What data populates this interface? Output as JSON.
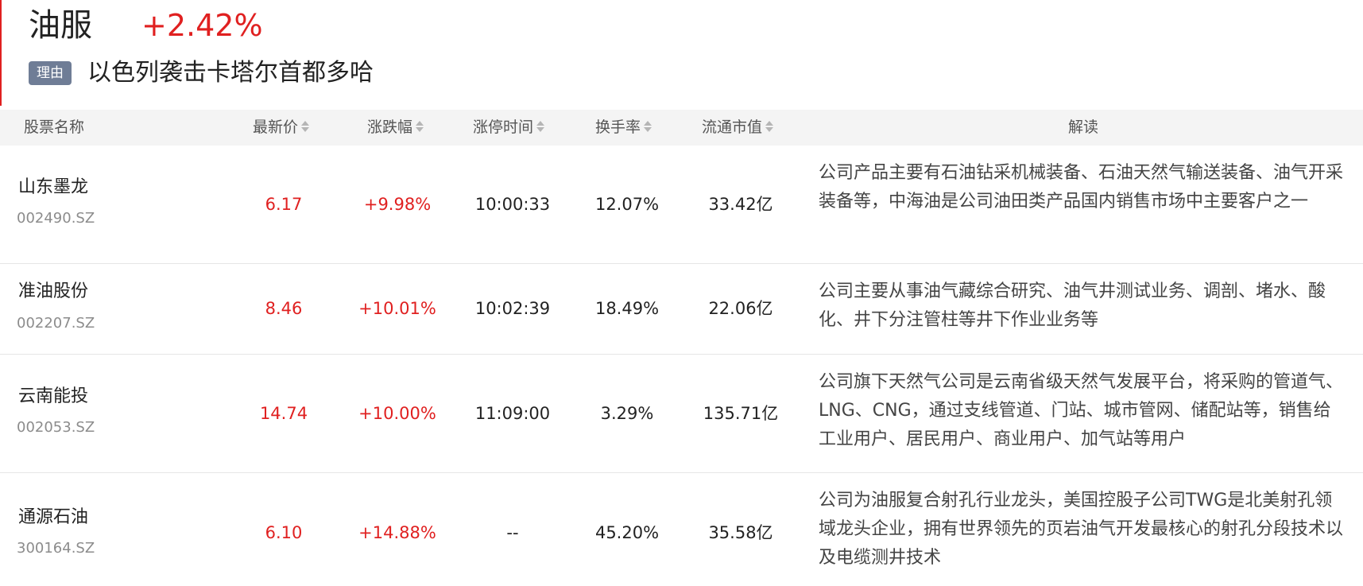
{
  "sector": {
    "name": "油服",
    "change": "+2.42%",
    "reason_tag": "理由",
    "reason_text": "以色列袭击卡塔尔首都多哈"
  },
  "columns": {
    "name": "股票名称",
    "price": "最新价",
    "change": "涨跌幅",
    "limit_time": "涨停时间",
    "turnover": "换手率",
    "float_cap": "流通市值",
    "analysis": "解读"
  },
  "rows": [
    {
      "name": "山东墨龙",
      "code": "002490.SZ",
      "price": "6.17",
      "change": "+9.98%",
      "limit_time": "10:00:33",
      "turnover": "12.07%",
      "float_cap": "33.42亿",
      "analysis": "公司产品主要有石油钻采机械装备、石油天然气输送装备、油气开采装备等，中海油是公司油田类产品国内销售市场中主要客户之一"
    },
    {
      "name": "准油股份",
      "code": "002207.SZ",
      "price": "8.46",
      "change": "+10.01%",
      "limit_time": "10:02:39",
      "turnover": "18.49%",
      "float_cap": "22.06亿",
      "analysis": "公司主要从事油气藏综合研究、油气井测试业务、调剖、堵水、酸化、井下分注管柱等井下作业业务等"
    },
    {
      "name": "云南能投",
      "code": "002053.SZ",
      "price": "14.74",
      "change": "+10.00%",
      "limit_time": "11:09:00",
      "turnover": "3.29%",
      "float_cap": "135.71亿",
      "analysis": "公司旗下天然气公司是云南省级天然气发展平台，将采购的管道气、LNG、CNG，通过支线管道、门站、城市管网、储配站等，销售给工业用户、居民用户、商业用户、加气站等用户"
    },
    {
      "name": "通源石油",
      "code": "300164.SZ",
      "price": "6.10",
      "change": "+14.88%",
      "limit_time": "--",
      "turnover": "45.20%",
      "float_cap": "35.58亿",
      "analysis": "公司为油服复合射孔行业龙头，美国控股子公司TWG是北美射孔领域龙头企业，拥有世界领先的页岩油气开发最核心的射孔分段技术以及电缆测井技术"
    }
  ],
  "colors": {
    "up": "#e02020",
    "tag_bg": "#6f7d96",
    "header_bg": "#f4f4f4"
  },
  "icons": {
    "sort": "sort-updown-icon"
  }
}
